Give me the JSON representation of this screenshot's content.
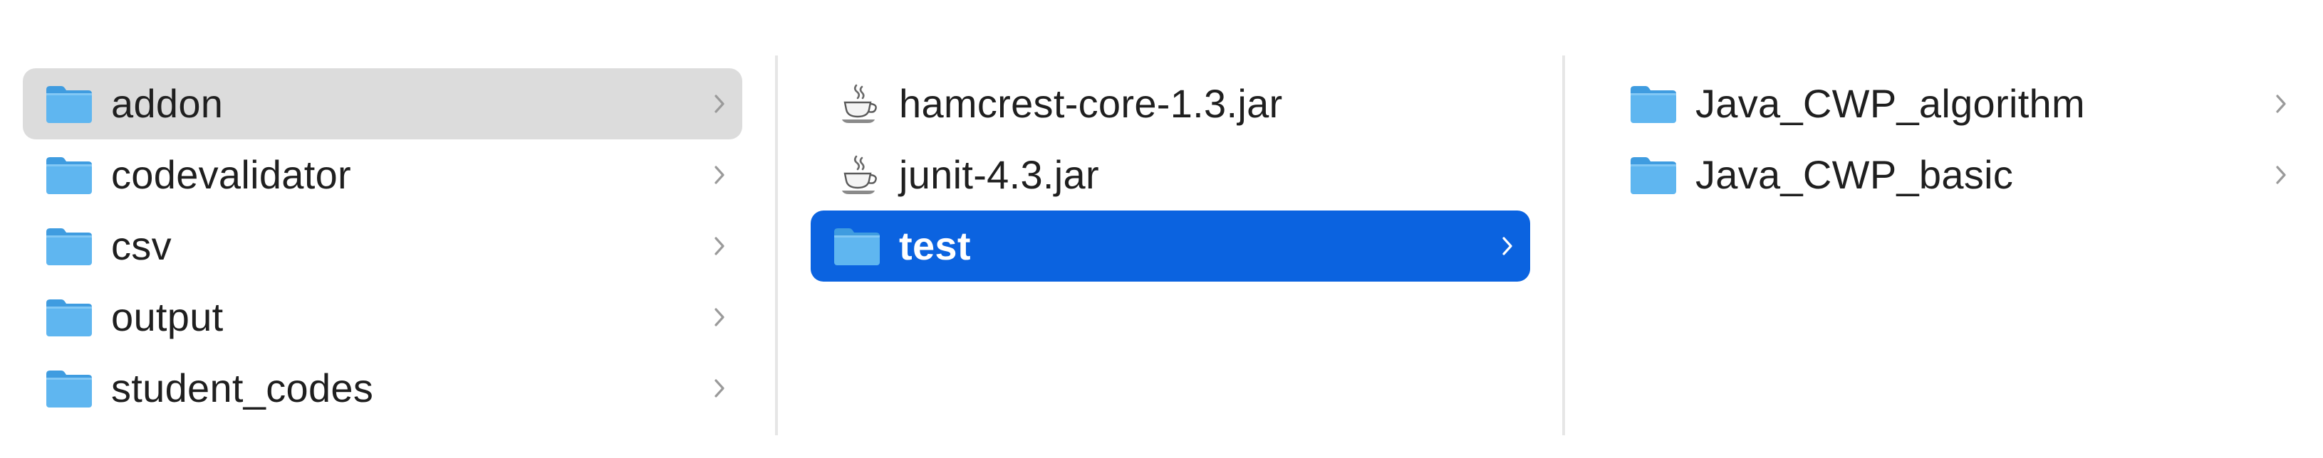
{
  "columns": [
    {
      "items": [
        {
          "name": "addon",
          "type": "folder",
          "has_children": true,
          "state": "selected-inactive"
        },
        {
          "name": "codevalidator",
          "type": "folder",
          "has_children": true,
          "state": "normal"
        },
        {
          "name": "csv",
          "type": "folder",
          "has_children": true,
          "state": "normal"
        },
        {
          "name": "output",
          "type": "folder",
          "has_children": true,
          "state": "normal"
        },
        {
          "name": "student_codes",
          "type": "folder",
          "has_children": true,
          "state": "normal"
        }
      ]
    },
    {
      "items": [
        {
          "name": "hamcrest-core-1.3.jar",
          "type": "java-archive",
          "has_children": false,
          "state": "normal"
        },
        {
          "name": "junit-4.3.jar",
          "type": "java-archive",
          "has_children": false,
          "state": "normal"
        },
        {
          "name": "test",
          "type": "folder",
          "has_children": true,
          "state": "selected-active"
        }
      ]
    },
    {
      "items": [
        {
          "name": "Java_CWP_algorithm",
          "type": "folder",
          "has_children": true,
          "state": "normal"
        },
        {
          "name": "Java_CWP_basic",
          "type": "folder",
          "has_children": true,
          "state": "normal"
        }
      ]
    }
  ],
  "icons": {
    "folder": "folder-icon",
    "java_archive": "java-jar-icon",
    "chevron": "chevron-right-icon"
  },
  "colors": {
    "selected_active_bg": "#0b63e0",
    "selected_inactive_bg": "#dcdcdc",
    "folder_blue": "#5fb6f0",
    "text": "#1f1f1f",
    "chevron": "#9a9a9a"
  }
}
